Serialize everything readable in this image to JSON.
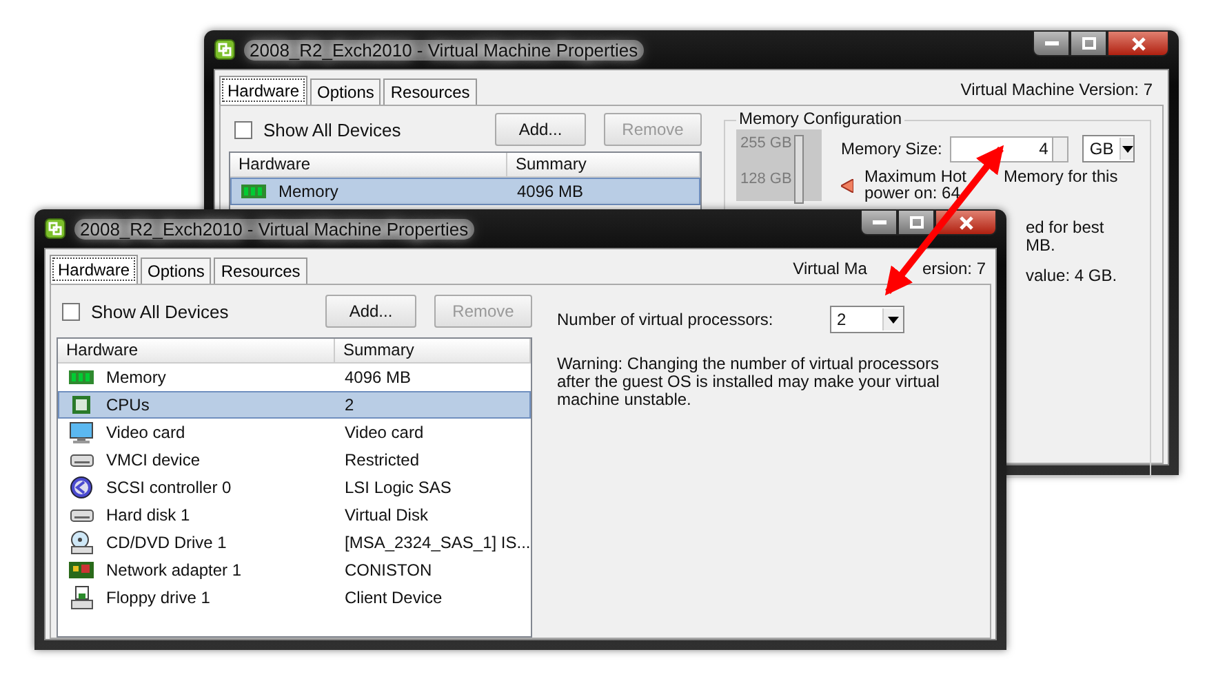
{
  "back_window": {
    "title": "2008_R2_Exch2010 - Virtual Machine Properties",
    "tabs": [
      {
        "label": "Hardware",
        "selected": true
      },
      {
        "label": "Options",
        "selected": false
      },
      {
        "label": "Resources",
        "selected": false
      }
    ],
    "version": "Virtual Machine Version: 7",
    "show_all_devices": {
      "label": "Show All Devices",
      "checked": false
    },
    "buttons": [
      {
        "label": "Add...",
        "disabled": false
      },
      {
        "label": "Remove",
        "disabled": true
      }
    ],
    "table": {
      "columns": [
        "Hardware",
        "Summary"
      ],
      "rows": [
        {
          "name": "Memory",
          "summary": "4096 MB",
          "kind": "memory",
          "selected": true
        }
      ]
    },
    "memory_configuration": {
      "title": "Memory Configuration",
      "slider_labels": [
        "255 GB",
        "128 GB"
      ],
      "size_label": "Memory Size:",
      "size_value": "4",
      "unit": "GB",
      "hot_add_note": [
        "Maximum Hot",
        "Memory for this",
        "power on: 64"
      ],
      "side_notes": [
        "ed for best",
        "MB.",
        "value: 4 GB."
      ]
    }
  },
  "front_window": {
    "title": "2008_R2_Exch2010 - Virtual Machine Properties",
    "tabs": [
      {
        "label": "Hardware",
        "selected": true
      },
      {
        "label": "Options",
        "selected": false
      },
      {
        "label": "Resources",
        "selected": false
      }
    ],
    "version_parts": [
      "Virtual Ma",
      "ersion: 7"
    ],
    "show_all_devices": {
      "label": "Show All Devices",
      "checked": false
    },
    "buttons": [
      {
        "label": "Add...",
        "disabled": false
      },
      {
        "label": "Remove",
        "disabled": true
      }
    ],
    "table": {
      "columns": [
        "Hardware",
        "Summary"
      ],
      "rows": [
        {
          "name": "Memory",
          "summary": "4096 MB",
          "kind": "memory",
          "selected": false
        },
        {
          "name": "CPUs",
          "summary": "2",
          "kind": "cpu",
          "selected": true
        },
        {
          "name": "Video card",
          "summary": "Video card",
          "kind": "monitor",
          "selected": false
        },
        {
          "name": "VMCI device",
          "summary": "Restricted",
          "kind": "drive",
          "selected": false
        },
        {
          "name": "SCSI controller 0",
          "summary": "LSI Logic SAS",
          "kind": "controller",
          "selected": false
        },
        {
          "name": "Hard disk 1",
          "summary": "Virtual Disk",
          "kind": "drive",
          "selected": false
        },
        {
          "name": "CD/DVD Drive 1",
          "summary": "[MSA_2324_SAS_1] IS...",
          "kind": "cd",
          "selected": false
        },
        {
          "name": "Network adapter 1",
          "summary": "CONISTON",
          "kind": "network",
          "selected": false
        },
        {
          "name": "Floppy drive 1",
          "summary": "Client Device",
          "kind": "floppy",
          "selected": false
        }
      ]
    },
    "processors": {
      "label": "Number of virtual processors:",
      "value": "2"
    },
    "warning": "Warning: Changing the number of virtual processors after the guest OS is installed may make your virtual machine unstable."
  }
}
